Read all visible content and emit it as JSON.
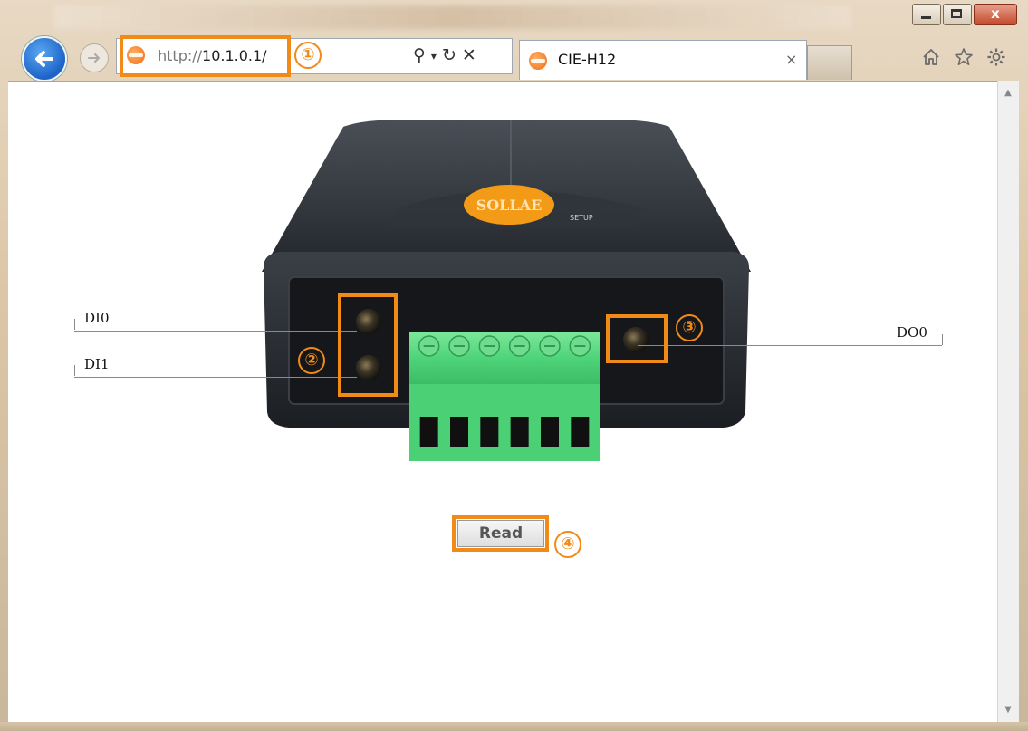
{
  "window": {
    "minimize_glyph": "minimize-icon",
    "maximize_glyph": "maximize-icon",
    "close_label": "x"
  },
  "browser": {
    "url_scheme": "http://",
    "url_host": "10.1.0.1/",
    "tab_title": "CIE-H12",
    "tab_close": "×",
    "icons": [
      "back-arrow-icon",
      "forward-arrow-icon",
      "search-icon",
      "dropdown-icon",
      "refresh-icon",
      "stop-icon",
      "home-icon",
      "favorites-star-icon",
      "settings-gear-icon"
    ]
  },
  "device": {
    "brand": "SOLLAE",
    "setup_text": "SETUP",
    "inputs": [
      {
        "label": "DI0"
      },
      {
        "label": "DI1"
      }
    ],
    "outputs": [
      {
        "label": "DO0"
      }
    ],
    "terminal_count": 6
  },
  "read_button": {
    "label": "Read"
  },
  "callouts": [
    "①",
    "②",
    "③",
    "④"
  ],
  "colors": {
    "callout": "#f28a18",
    "terminal_block": "#4fd47a",
    "device_body": "#2b2f35",
    "back_button": "#1d63c8"
  }
}
